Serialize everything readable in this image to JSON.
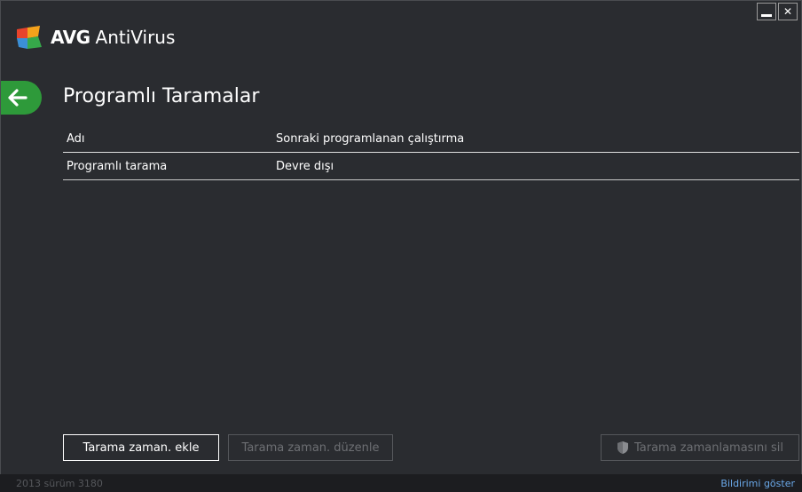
{
  "app": {
    "brand": "AVG",
    "product": "AntiVirus"
  },
  "page": {
    "title": "Programlı Taramalar"
  },
  "table": {
    "columns": [
      "Adı",
      "Sonraki programlanan çalıştırma"
    ],
    "rows": [
      {
        "name": "Programlı tarama",
        "next_run": "Devre dışı"
      }
    ]
  },
  "buttons": {
    "add": "Tarama zaman. ekle",
    "edit": "Tarama zaman. düzenle",
    "delete": "Tarama zamanlamasını sil"
  },
  "status": {
    "version": "2013  sürüm 3180",
    "notification_link": "Bildirimi göster"
  },
  "colors": {
    "background": "#2a2c30",
    "accent_green": "#2e9a3a",
    "link_blue": "#6aa8e8"
  },
  "icons": {
    "back": "back-arrow-icon",
    "minimize": "minimize-icon",
    "close": "close-icon",
    "shield": "shield-icon"
  }
}
